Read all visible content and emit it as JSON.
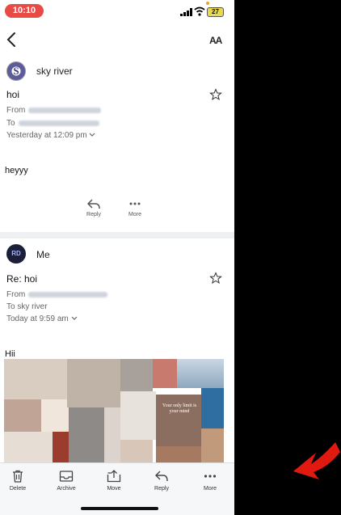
{
  "status_bar": {
    "time": "10:10",
    "battery": "27"
  },
  "header": {
    "text_size_label": "AA"
  },
  "message1": {
    "avatar_letter": "S",
    "sender": "sky river",
    "subject": "hoi",
    "from_label": "From",
    "to_label": "To",
    "date": "Yesterday at 12:09 pm",
    "body": "heyyy",
    "actions": [
      {
        "label": "Reply"
      },
      {
        "label": "More"
      }
    ]
  },
  "message2": {
    "avatar_text": "RD",
    "sender": "Me",
    "subject": "Re: hoi",
    "from_label": "From",
    "to_line": "To sky river",
    "date": "Today at 9:59 am",
    "body": "Hii",
    "image_text": "Your only limit is your mind"
  },
  "toolbar": {
    "items": [
      {
        "label": "Delete"
      },
      {
        "label": "Archive"
      },
      {
        "label": "Move"
      },
      {
        "label": "Reply"
      },
      {
        "label": "More"
      }
    ]
  },
  "colors": {
    "time_pill": "#e84b45",
    "arrow": "#e01a10",
    "toolbar_bg": "#f6f7f8"
  }
}
